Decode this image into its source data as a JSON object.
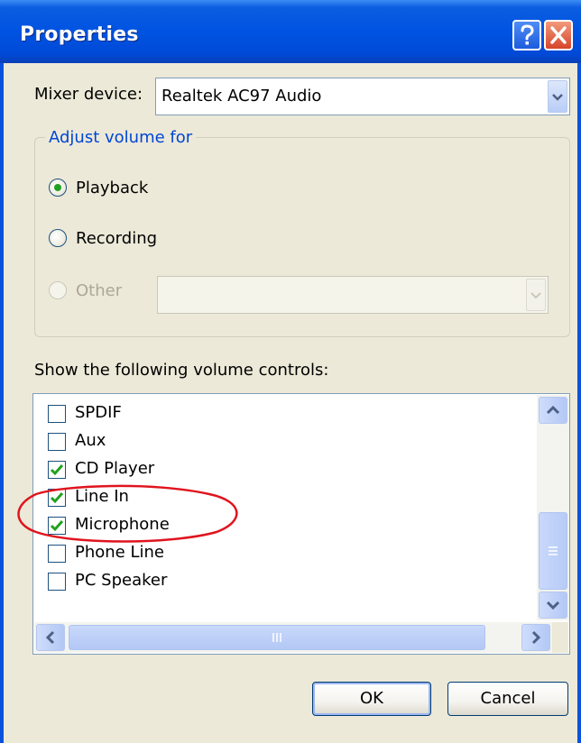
{
  "window": {
    "title": "Properties"
  },
  "mixer": {
    "label": "Mixer device:",
    "value": "Realtek AC97 Audio"
  },
  "adjust_group": {
    "legend": "Adjust volume for",
    "options": [
      {
        "label": "Playback",
        "selected": true,
        "enabled": true
      },
      {
        "label": "Recording",
        "selected": false,
        "enabled": true
      },
      {
        "label": "Other",
        "selected": false,
        "enabled": false
      }
    ],
    "other_value": ""
  },
  "controls": {
    "label": "Show the following volume controls:",
    "items": [
      {
        "label": "SPDIF",
        "checked": false
      },
      {
        "label": "Aux",
        "checked": false
      },
      {
        "label": "CD Player",
        "checked": true
      },
      {
        "label": "Line In",
        "checked": true
      },
      {
        "label": "Microphone",
        "checked": true
      },
      {
        "label": "Phone Line",
        "checked": false
      },
      {
        "label": "PC Speaker",
        "checked": false
      }
    ]
  },
  "buttons": {
    "ok": "OK",
    "cancel": "Cancel"
  },
  "icons": {
    "help": "question-mark-icon",
    "close": "close-x-icon",
    "dropdown": "chevron-down-icon",
    "scroll_up": "arrow-up-icon",
    "scroll_down": "arrow-down-icon",
    "scroll_left": "arrow-left-icon",
    "scroll_right": "arrow-right-icon",
    "check": "checkmark-icon"
  },
  "colors": {
    "title_bar": "#0053e1",
    "dialog_bg": "#ece9d8",
    "group_legend": "#0046d5",
    "check_mark": "#21a121",
    "annotation": "#e0141e"
  }
}
